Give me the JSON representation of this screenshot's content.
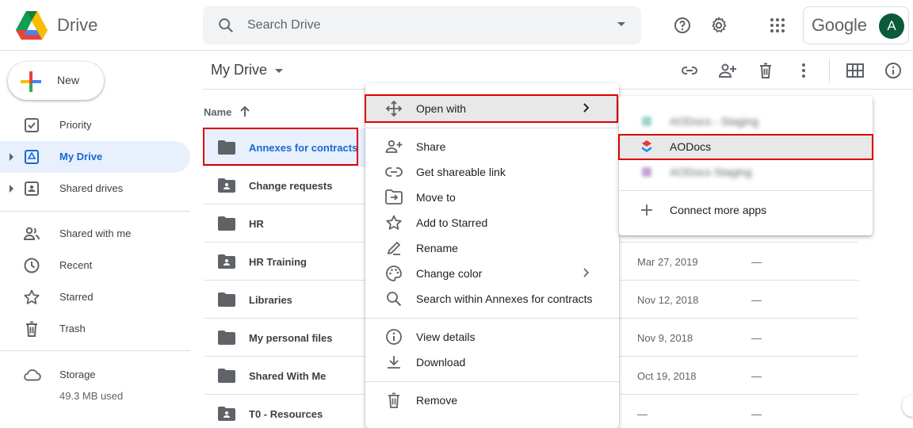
{
  "header": {
    "app_name": "Drive",
    "search_placeholder": "Search Drive",
    "google_word": "Google",
    "avatar_letter": "A"
  },
  "sidebar": {
    "new_label": "New",
    "items": [
      {
        "label": "Priority",
        "icon": "priority-icon"
      },
      {
        "label": "My Drive",
        "icon": "my-drive-icon",
        "active": true
      },
      {
        "label": "Shared drives",
        "icon": "shared-drives-icon"
      },
      {
        "label": "Shared with me",
        "icon": "shared-with-me-icon"
      },
      {
        "label": "Recent",
        "icon": "clock-icon"
      },
      {
        "label": "Starred",
        "icon": "star-icon"
      },
      {
        "label": "Trash",
        "icon": "trash-icon"
      }
    ],
    "storage_label": "Storage",
    "storage_used": "49.3 MB used"
  },
  "main": {
    "title": "My Drive",
    "column_name": "Name",
    "rows": [
      {
        "name": "Annexes for contracts",
        "type": "folder",
        "date": "",
        "size": ""
      },
      {
        "name": "Change requests",
        "type": "shared-folder",
        "date": "",
        "size": ""
      },
      {
        "name": "HR",
        "type": "folder",
        "date": "",
        "size": ""
      },
      {
        "name": "HR Training",
        "type": "shared-folder",
        "date": "Mar 27, 2019",
        "size": "—"
      },
      {
        "name": "Libraries",
        "type": "folder",
        "date": "Nov 12, 2018",
        "size": "—"
      },
      {
        "name": "My personal files",
        "type": "folder",
        "date": "Nov 9, 2018",
        "size": "—"
      },
      {
        "name": "Shared With Me",
        "type": "folder",
        "date": "Oct 19, 2018",
        "size": "—"
      },
      {
        "name": "T0 - Resources",
        "type": "shared-folder",
        "date": "—",
        "size": "—"
      }
    ]
  },
  "context_menu": {
    "items": [
      {
        "label": "Open with",
        "icon": "open-with-icon"
      },
      {
        "label": "Share",
        "icon": "share-icon"
      },
      {
        "label": "Get shareable link",
        "icon": "link-icon"
      },
      {
        "label": "Move to",
        "icon": "move-to-icon"
      },
      {
        "label": "Add to Starred",
        "icon": "star-icon"
      },
      {
        "label": "Rename",
        "icon": "rename-icon"
      },
      {
        "label": "Change color",
        "icon": "palette-icon"
      },
      {
        "label": "Search within Annexes for contracts",
        "icon": "search-icon"
      },
      {
        "label": "View details",
        "icon": "info-icon"
      },
      {
        "label": "Download",
        "icon": "download-icon"
      },
      {
        "label": "Remove",
        "icon": "trash-icon"
      }
    ]
  },
  "submenu": {
    "items": [
      {
        "label": "AODocs - Staging",
        "icon": "app-icon",
        "blurred": true
      },
      {
        "label": "AODocs",
        "icon": "aodocs-icon"
      },
      {
        "label": "AODocs Staging",
        "icon": "app-icon",
        "blurred": true
      },
      {
        "label": "Connect more apps",
        "icon": "plus-icon"
      }
    ]
  },
  "colors": {
    "accent": "#1967d2",
    "highlight_box": "#dd0000",
    "avatar_bg": "#0b5b3b"
  }
}
